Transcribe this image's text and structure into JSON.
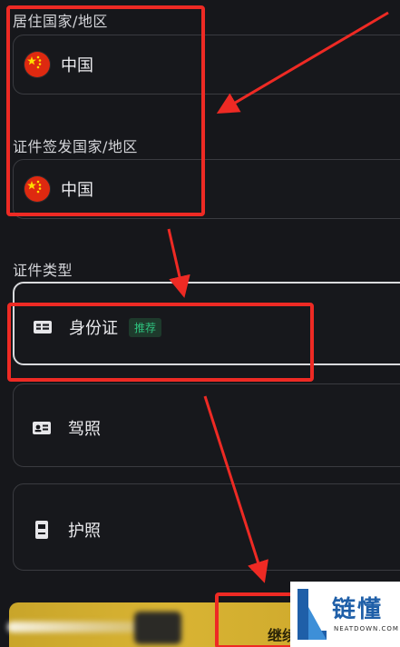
{
  "residence": {
    "label": "居住国家/地区",
    "country": "中国",
    "flag_icon": "china-flag-icon"
  },
  "issuing": {
    "label": "证件签发国家/地区",
    "country": "中国",
    "flag_icon": "china-flag-icon"
  },
  "document_type": {
    "label": "证件类型",
    "options": [
      {
        "label": "身份证",
        "badge": "推荐",
        "icon": "id-card-icon",
        "selected": true
      },
      {
        "label": "驾照",
        "badge": "",
        "icon": "driver-license-icon",
        "selected": false
      },
      {
        "label": "护照",
        "badge": "",
        "icon": "passport-icon",
        "selected": false
      }
    ]
  },
  "footer": {
    "continue_label": "继续"
  },
  "watermark": {
    "brand": "链懂",
    "domain": "NEATDOWN.COM"
  },
  "colors": {
    "background": "#16171b",
    "annotation_red": "#ee2a24",
    "recommend_green": "#2ec27e",
    "button_gold": "#d9b433"
  }
}
